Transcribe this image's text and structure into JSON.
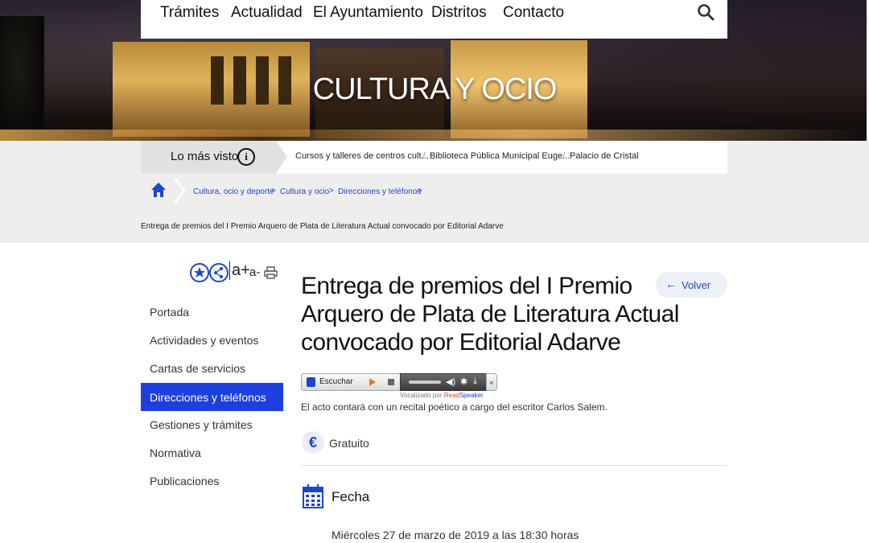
{
  "nav": {
    "items": [
      "Trámites",
      "Actualidad",
      "El Ayuntamiento",
      "Distritos",
      "Contacto"
    ],
    "search_icon": "search-icon"
  },
  "hero": {
    "title": "CULTURA Y OCIO"
  },
  "most_viewed": {
    "label": "Lo más visto",
    "links": [
      "Cursos y talleres de centros cult...",
      "Biblioteca Pública Municipal Euge...",
      "Palacio de Cristal"
    ]
  },
  "breadcrumb": {
    "items": [
      "Cultura, ocio y deporte",
      "Cultura y ocio",
      "Direcciones y teléfonos"
    ],
    "separator": ">",
    "current": "Entrega de premios del I Premio Arquero de Plata de Literatura Actual convocado por Editorial Adarve"
  },
  "tools": {
    "font_up": "a+",
    "font_down": "a-"
  },
  "sidebar": {
    "items": [
      "Portada",
      "Actividades y eventos",
      "Cartas de servicios",
      "Direcciones y teléfonos",
      "Gestiones y trámites",
      "Normativa",
      "Publicaciones"
    ],
    "active_index": 3
  },
  "main": {
    "title": "Entrega de premios del I Premio Arquero de Plata de Literatura Actual convocado por Editorial Adarve",
    "back_label": "Volver",
    "player": {
      "listen_label": "Escuchar",
      "voiced_by": "Vocalizado por",
      "brand_read": "Read",
      "brand_speaker": "Speaker",
      "collapse": "«"
    },
    "description": "El acto contará con un recital poético a cargo del escritor Carlos Salem.",
    "price": {
      "symbol": "€",
      "label": "Gratuito"
    },
    "date": {
      "heading": "Fecha",
      "value": "Miércoles 27 de marzo de 2019 a las 18:30 horas"
    }
  },
  "colors": {
    "accent": "#1d3fe0",
    "link": "#1b47c9"
  }
}
